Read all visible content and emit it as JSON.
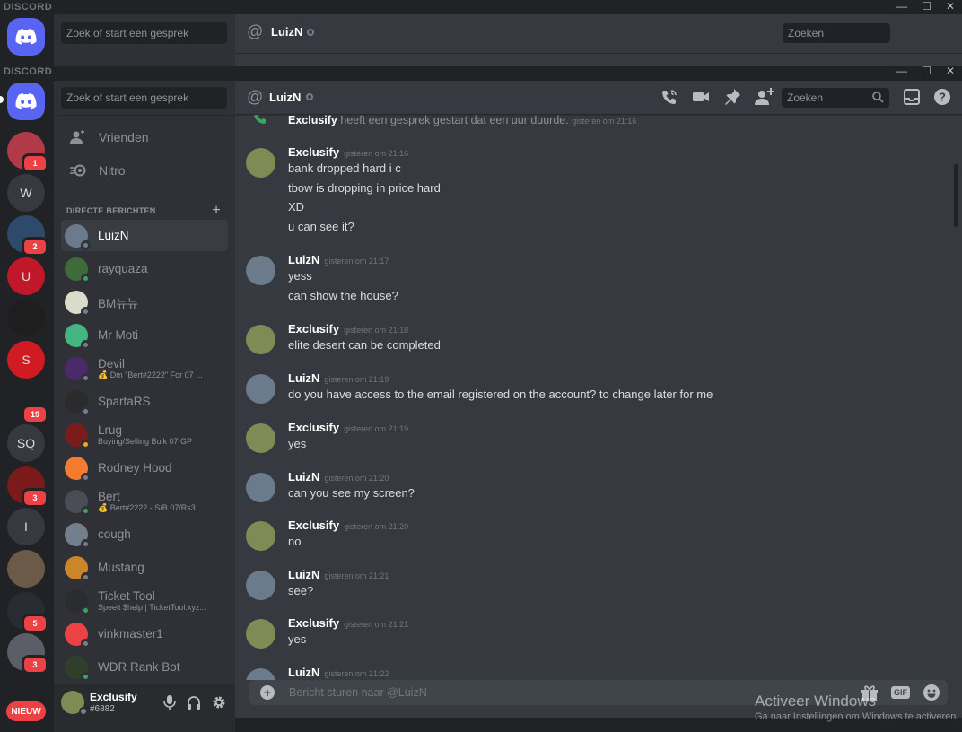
{
  "app": {
    "brand": "DISCORD",
    "window_controls": [
      "—",
      "☐",
      "✕"
    ]
  },
  "search_placeholder": "Zoek of start een gesprek",
  "nav": {
    "friends": "Vrienden",
    "nitro": "Nitro"
  },
  "dm_section_title": "DIRECTE BERICHTEN",
  "guilds": [
    {
      "label": "",
      "badge": "1",
      "color": "#b03a48"
    },
    {
      "label": "W",
      "badge": "",
      "color": "#36393f"
    },
    {
      "label": "",
      "badge": "2",
      "color": "#2e4a6b"
    },
    {
      "label": "U",
      "badge": "",
      "color": "#c0182a"
    },
    {
      "label": "",
      "badge": "",
      "color": "#1e1e1e"
    },
    {
      "label": "S",
      "badge": "",
      "color": "#d01b22"
    },
    {
      "label": "",
      "badge": "19",
      "color": "#202225"
    },
    {
      "label": "SQ",
      "badge": "",
      "color": "#36393f"
    },
    {
      "label": "",
      "badge": "3",
      "color": "#7a1a1a"
    },
    {
      "label": "I",
      "badge": "",
      "color": "#36393f"
    },
    {
      "label": "",
      "badge": "",
      "color": "#6b5a48"
    },
    {
      "label": "",
      "badge": "5",
      "color": "#2a2c33"
    },
    {
      "label": "",
      "badge": "3",
      "color": "#5b5e66"
    }
  ],
  "new_badge": "NIEUW",
  "dms": [
    {
      "name": "LuizN",
      "status": "offline",
      "active": true,
      "color": "#6b7b8c"
    },
    {
      "name": "rayquaza",
      "status": "online",
      "color": "#3d6b3a"
    },
    {
      "name": "BM뉴뉴",
      "status": "offline",
      "color": "#d9dcc8"
    },
    {
      "name": "Mr Moti",
      "status": "offline",
      "color": "#43b581"
    },
    {
      "name": "Devil",
      "sub": "💰 Dm \"Bert#2222\" For 07 ...",
      "status": "offline",
      "color": "#4a2a6b"
    },
    {
      "name": "SpartaRS",
      "status": "offline",
      "color": "#2b2b2b"
    },
    {
      "name": "Lrug",
      "sub": "Buying/Selling Bulk 07 GP",
      "status": "idle",
      "color": "#7a1c1c"
    },
    {
      "name": "Rodney Hood",
      "status": "offline",
      "color": "#f47b30"
    },
    {
      "name": "Bert",
      "sub": "💰 Bert#2222 - S/B 07/Rs3",
      "status": "online",
      "color": "#4a4d55"
    },
    {
      "name": "cough",
      "status": "offline",
      "color": "#747f8d"
    },
    {
      "name": "Mustang",
      "status": "offline",
      "color": "#c9862a"
    },
    {
      "name": "Ticket Tool",
      "sub": "Speelt $help | TicketTool.xyz...",
      "status": "online",
      "color": "#2a2c30"
    },
    {
      "name": "vinkmaster1",
      "status": "offline",
      "color": "#ed4245"
    },
    {
      "name": "WDR Rank Bot",
      "status": "online",
      "color": "#2f3f2a"
    }
  ],
  "user": {
    "name": "Exclusify",
    "tag": "#6882"
  },
  "chat": {
    "recipient": "LuizN",
    "search_placeholder": "Zoeken",
    "system": {
      "author": "Exclusify",
      "text": " heeft een gesprek gestart dat een uur duurde.",
      "time": "gisteren om 21:16"
    },
    "messages": [
      {
        "author": "Exclusify",
        "time": "gisteren om 21:16",
        "lines": [
          "bank dropped hard i c",
          "tbow is dropping in price hard",
          "XD",
          "u can see it?"
        ]
      },
      {
        "author": "LuizN",
        "time": "gisteren om 21:17",
        "lines": [
          "yess",
          "can show the house?"
        ]
      },
      {
        "author": "Exclusify",
        "time": "gisteren om 21:18",
        "lines": [
          "elite desert can be completed"
        ]
      },
      {
        "author": "LuizN",
        "time": "gisteren om 21:19",
        "lines": [
          "do you have access to the email registered on the account? to change later for me"
        ]
      },
      {
        "author": "Exclusify",
        "time": "gisteren om 21:19",
        "lines": [
          "yes"
        ]
      },
      {
        "author": "LuizN",
        "time": "gisteren om 21:20",
        "lines": [
          "can you see my screen?"
        ]
      },
      {
        "author": "Exclusify",
        "time": "gisteren om 21:20",
        "lines": [
          "no"
        ]
      },
      {
        "author": "LuizN",
        "time": "gisteren om 21:21",
        "lines": [
          "see?"
        ]
      },
      {
        "author": "Exclusify",
        "time": "gisteren om 21:21",
        "lines": [
          "yes"
        ]
      },
      {
        "author": "LuizN",
        "time": "gisteren om 21:22",
        "lines": []
      }
    ],
    "composer_placeholder": "Bericht sturen naar @LuizN"
  },
  "watermark": {
    "line1": "Activeer Windows",
    "line2": "Ga naar Instellingen om Windows te activeren."
  },
  "colors": {
    "blurple": "#5865f2",
    "exclusify_avatar": "#7f8a55",
    "luizn_avatar": "#6b7b8c"
  }
}
